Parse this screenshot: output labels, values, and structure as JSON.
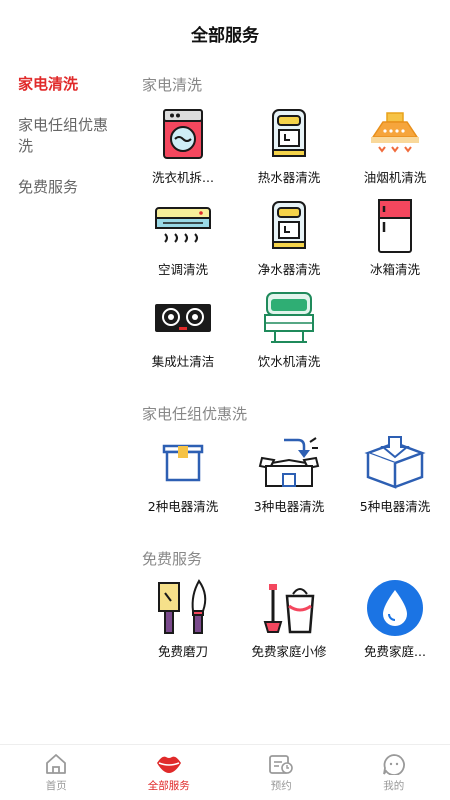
{
  "header": {
    "title": "全部服务"
  },
  "sidebar": {
    "items": [
      {
        "label": "家电清洗"
      },
      {
        "label": "家电任组优惠洗"
      },
      {
        "label": "免费服务"
      }
    ]
  },
  "sections": [
    {
      "title": "家电清洗",
      "items": [
        {
          "label": "洗衣机拆...",
          "icon": "washing-machine-icon"
        },
        {
          "label": "热水器清洗",
          "icon": "water-heater-icon"
        },
        {
          "label": "油烟机清洗",
          "icon": "range-hood-icon"
        },
        {
          "label": "空调清洗",
          "icon": "air-conditioner-icon"
        },
        {
          "label": "净水器清洗",
          "icon": "water-purifier-icon"
        },
        {
          "label": "冰箱清洗",
          "icon": "refrigerator-icon"
        },
        {
          "label": "集成灶清洁",
          "icon": "gas-stove-icon"
        },
        {
          "label": "饮水机清洗",
          "icon": "water-dispenser-icon"
        }
      ]
    },
    {
      "title": "家电任组优惠洗",
      "items": [
        {
          "label": "2种电器清洗",
          "icon": "box-icon"
        },
        {
          "label": "3种电器清洗",
          "icon": "open-box-icon"
        },
        {
          "label": "5种电器清洗",
          "icon": "box-download-icon"
        }
      ]
    },
    {
      "title": "免费服务",
      "items": [
        {
          "label": "免费磨刀",
          "icon": "knives-icon"
        },
        {
          "label": "免费家庭小修",
          "icon": "tools-icon"
        },
        {
          "label": "免费家庭...",
          "icon": "water-drop-icon"
        }
      ]
    }
  ],
  "tabbar": {
    "items": [
      {
        "label": "首页",
        "icon": "home-icon"
      },
      {
        "label": "全部服务",
        "icon": "lips-icon"
      },
      {
        "label": "预约",
        "icon": "calendar-icon"
      },
      {
        "label": "我的",
        "icon": "profile-icon"
      }
    ]
  },
  "colors": {
    "accent": "#e02a2a",
    "muted": "#999999"
  }
}
